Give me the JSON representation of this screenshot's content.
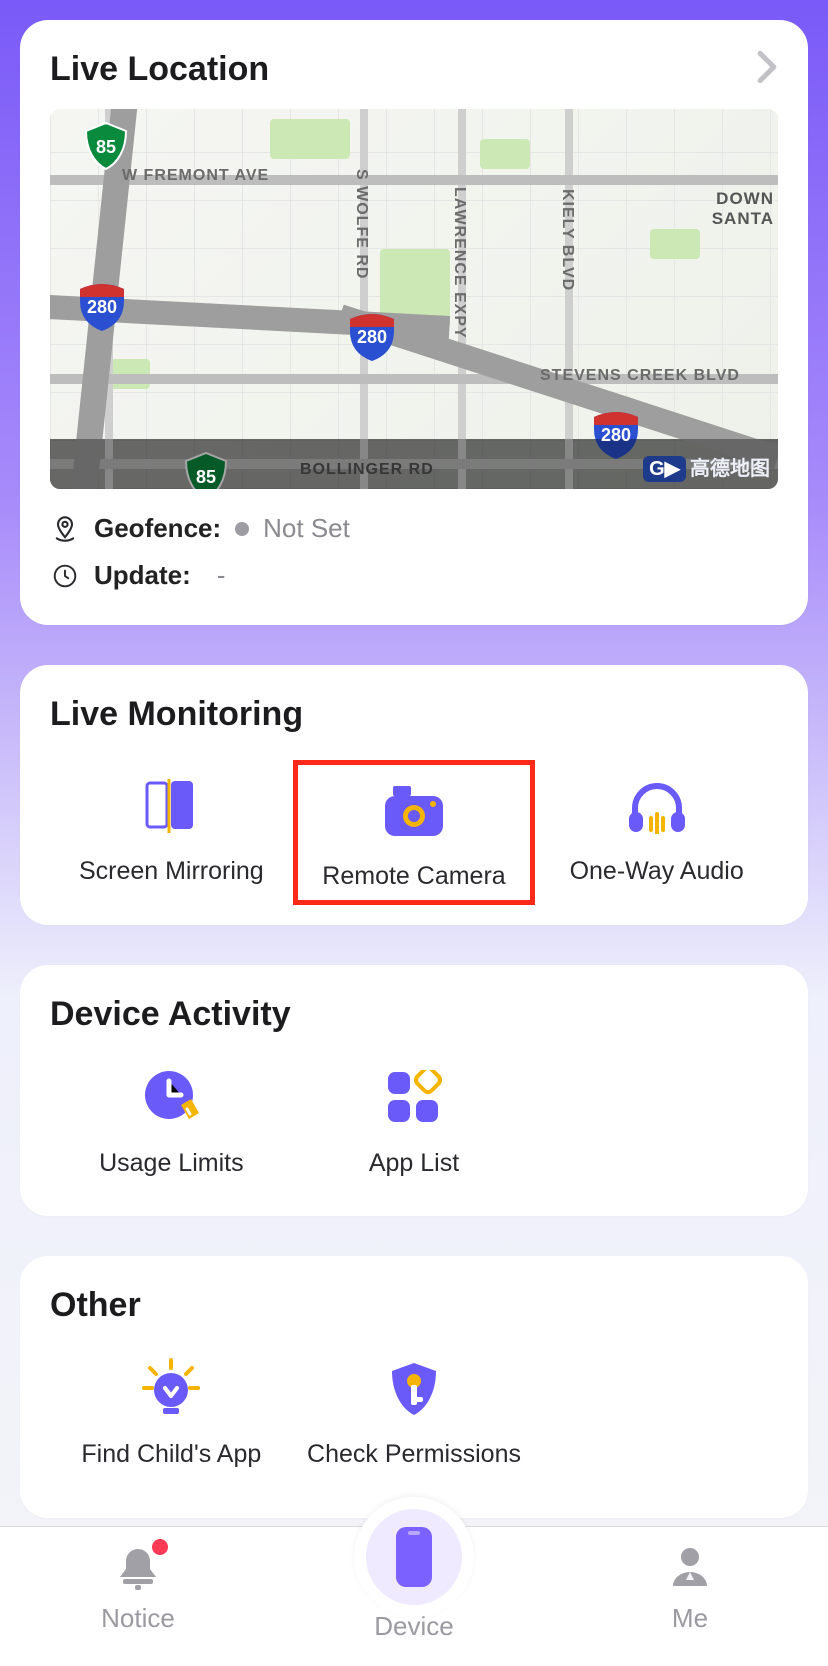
{
  "location": {
    "title": "Live Location",
    "geofence_label": "Geofence:",
    "geofence_value": "Not Set",
    "update_label": "Update:",
    "update_value": "-",
    "map_labels": {
      "fremont": "W FREMONT AVE",
      "swolfe": "S WOLFE RD",
      "lawrence": "LAWRENCE EXPY",
      "kiely": "KIELY BLVD",
      "stevens": "STEVENS CREEK BLVD",
      "bollinger": "BOLLINGER RD",
      "down": "DOWN",
      "santa": "SANTA"
    },
    "shields": {
      "i280": "280",
      "sr85": "85"
    },
    "amap_g": "G▶",
    "amap_cn": "高德地图"
  },
  "monitoring": {
    "title": "Live Monitoring",
    "tiles": {
      "screen_mirroring": "Screen Mirroring",
      "remote_camera": "Remote Camera",
      "one_way_audio": "One-Way Audio"
    }
  },
  "activity": {
    "title": "Device Activity",
    "tiles": {
      "usage_limits": "Usage Limits",
      "app_list": "App List"
    }
  },
  "other": {
    "title": "Other",
    "tiles": {
      "find_child": "Find Child's App",
      "check_perms": "Check Permissions"
    }
  },
  "tabs": {
    "notice": "Notice",
    "device": "Device",
    "me": "Me"
  }
}
